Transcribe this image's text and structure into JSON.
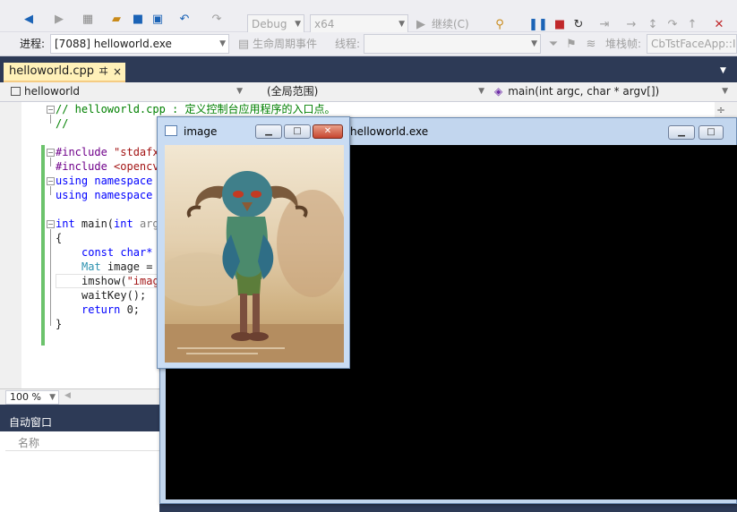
{
  "toolbar": {
    "config": "Debug",
    "platform": "x64",
    "continue_label": "继续(C)"
  },
  "toolbar2": {
    "process_label": "进程:",
    "process_value": "[7088] helloworld.exe",
    "lifecycle_label": "生命周期事件",
    "thread_label": "线程:",
    "stack_label": "堆栈帧:",
    "stack_value": "CbTstFaceApp::I"
  },
  "tabs": {
    "active": "helloworld.cpp",
    "pin": "ヰ",
    "close": "×"
  },
  "editor_bar": {
    "project": "helloworld",
    "scope": "(全局范围)",
    "member": "main(int argc, char * argv[])"
  },
  "code": {
    "l1": "// helloworld.cpp : 定义控制台应用程序的入口点。",
    "l2": "//",
    "l3a": "#include ",
    "l3b": "\"stdafx",
    "l4a": "#include ",
    "l4b": "<opencv",
    "l5a": "using namespace",
    "l6a": "using namespace",
    "l7a": "int",
    "l7b": " main(",
    "l7c": "int",
    "l7d": " arg",
    "l8": "{",
    "l9a": "const",
    "l9b": " char*",
    "l10a": "Mat",
    "l10b": " image =",
    "l11a": "imshow(",
    "l11b": "\"imag",
    "l12": "waitKey();",
    "l13a": "return",
    "l13b": " 0;",
    "l14": "}"
  },
  "zoom": "100 %",
  "auto_panel": {
    "title": "自动窗口",
    "column_name": "名称"
  },
  "image_window": {
    "title": "image",
    "btn_min": "▁",
    "btn_max": "□",
    "btn_close": "✕"
  },
  "console_window": {
    "title": "helloworld.exe",
    "btn_min": "▁",
    "btn_max": "□"
  },
  "colors": {
    "accent": "#1b63b6",
    "tab_active": "#fff1b9",
    "change_bar": "#6cc36c",
    "frame_dark": "#2d3a56"
  }
}
